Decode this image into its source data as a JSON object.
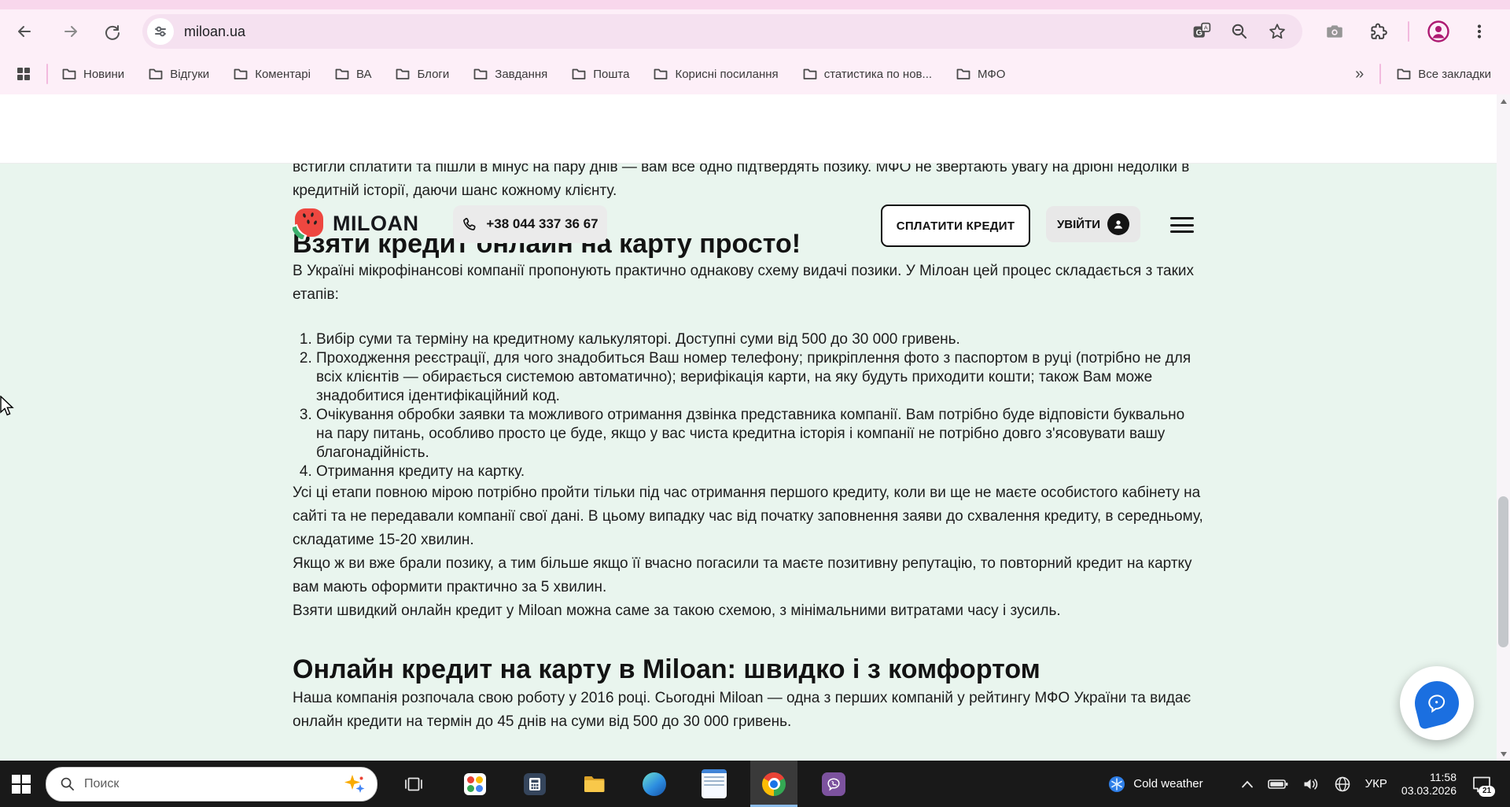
{
  "browser": {
    "address": "miloan.ua",
    "bookmarks": [
      "Новини",
      "Відгуки",
      "Коментарі",
      "ВА",
      "Блоги",
      "Завдання",
      "Пошта",
      "Корисні посилання",
      "статистика по нов...",
      "МФО"
    ],
    "overflow_chevron": "»",
    "all_bookmarks_label": "Все закладки"
  },
  "site": {
    "logo": "MILOAN",
    "phone": "+38 044 337 36 67",
    "pay_button": "СПЛАТИТИ КРЕДИТ",
    "login_button": "УВІЙТИ"
  },
  "article": {
    "lede_clipped": "встигли сплатити та пішли в мінус на пару днів — вам все одно підтвердять позику. МФО не звертають увагу на дрібні недоліки в кредитній історії, даючи шанс кожному клієнту.",
    "h1": "Взяти кредит онлайн на карту просто!",
    "intro": "В Україні мікрофінансові компанії пропонують практично однакову схему видачі позики. У Мілоан цей процес складається з таких етапів:",
    "steps": [
      "Вибір суми та терміну на кредитному калькуляторі. Доступні суми від 500 до 30 000 гривень.",
      "Проходження реєстрації, для чого знадобиться Ваш номер телефону; прикріплення фото з паспортом в руці (потрібно не для всіх клієнтів — обирається системою автоматично); верифікація карти, на яку будуть приходити кошти; також Вам може знадобитися ідентифікаційний код.",
      "Очікування обробки заявки та можливого отримання дзвінка представника компанії. Вам потрібно буде відповісти буквально на пару питань, особливо просто це буде, якщо у вас чиста кредитна історія і компанії не потрібно довго з'ясовувати вашу благонадійність.",
      "Отримання кредиту на картку."
    ],
    "p_all_stages": "Усі ці етапи повною мірою потрібно пройти тільки під час отримання першого кредиту, коли ви ще не маєте особистого кабінету на сайті та не передавали компанії свої дані. В цьому випадку час від початку заповнення заяви до схвалення кредиту, в середньому, складатиме 15-20 хвилин.",
    "p_repeat": "Якщо ж ви вже брали позику, а тим більше якщо її вчасно погасили та маєте позитивну репутацію, то повторний кредит на картку вам мають оформити практично за 5 хвилин.",
    "p_scheme": "Взяти швидкий онлайн кредит у Miloan можна саме за такою схемою, з мінімальними витратами часу і зусиль.",
    "h2": "Онлайн кредит на карту в Miloan: швидко і з комфортом",
    "p_company": "Наша компанія розпочала свою роботу у 2016 році. Сьогодні Miloan — одна з перших компаній у рейтингу МФО України та",
    "p_company_clipped": "видає онлайн кредити на термін до 45 днів на суми від 500 до 30 000 гривень."
  },
  "taskbar": {
    "search_placeholder": "Поиск",
    "weather_label": "Cold weather",
    "language": "УКР",
    "time": "11:58",
    "date": "03.03.2026",
    "notification_count": "21"
  },
  "colors": {
    "chrome_theme": "#fdeff8",
    "chrome_theme_dark": "#f8d7ec",
    "content_bg": "#e9f5ee",
    "accent_blue": "#1b6fe0",
    "brand_red": "#ee4740",
    "brand_green": "#3cb06d"
  }
}
